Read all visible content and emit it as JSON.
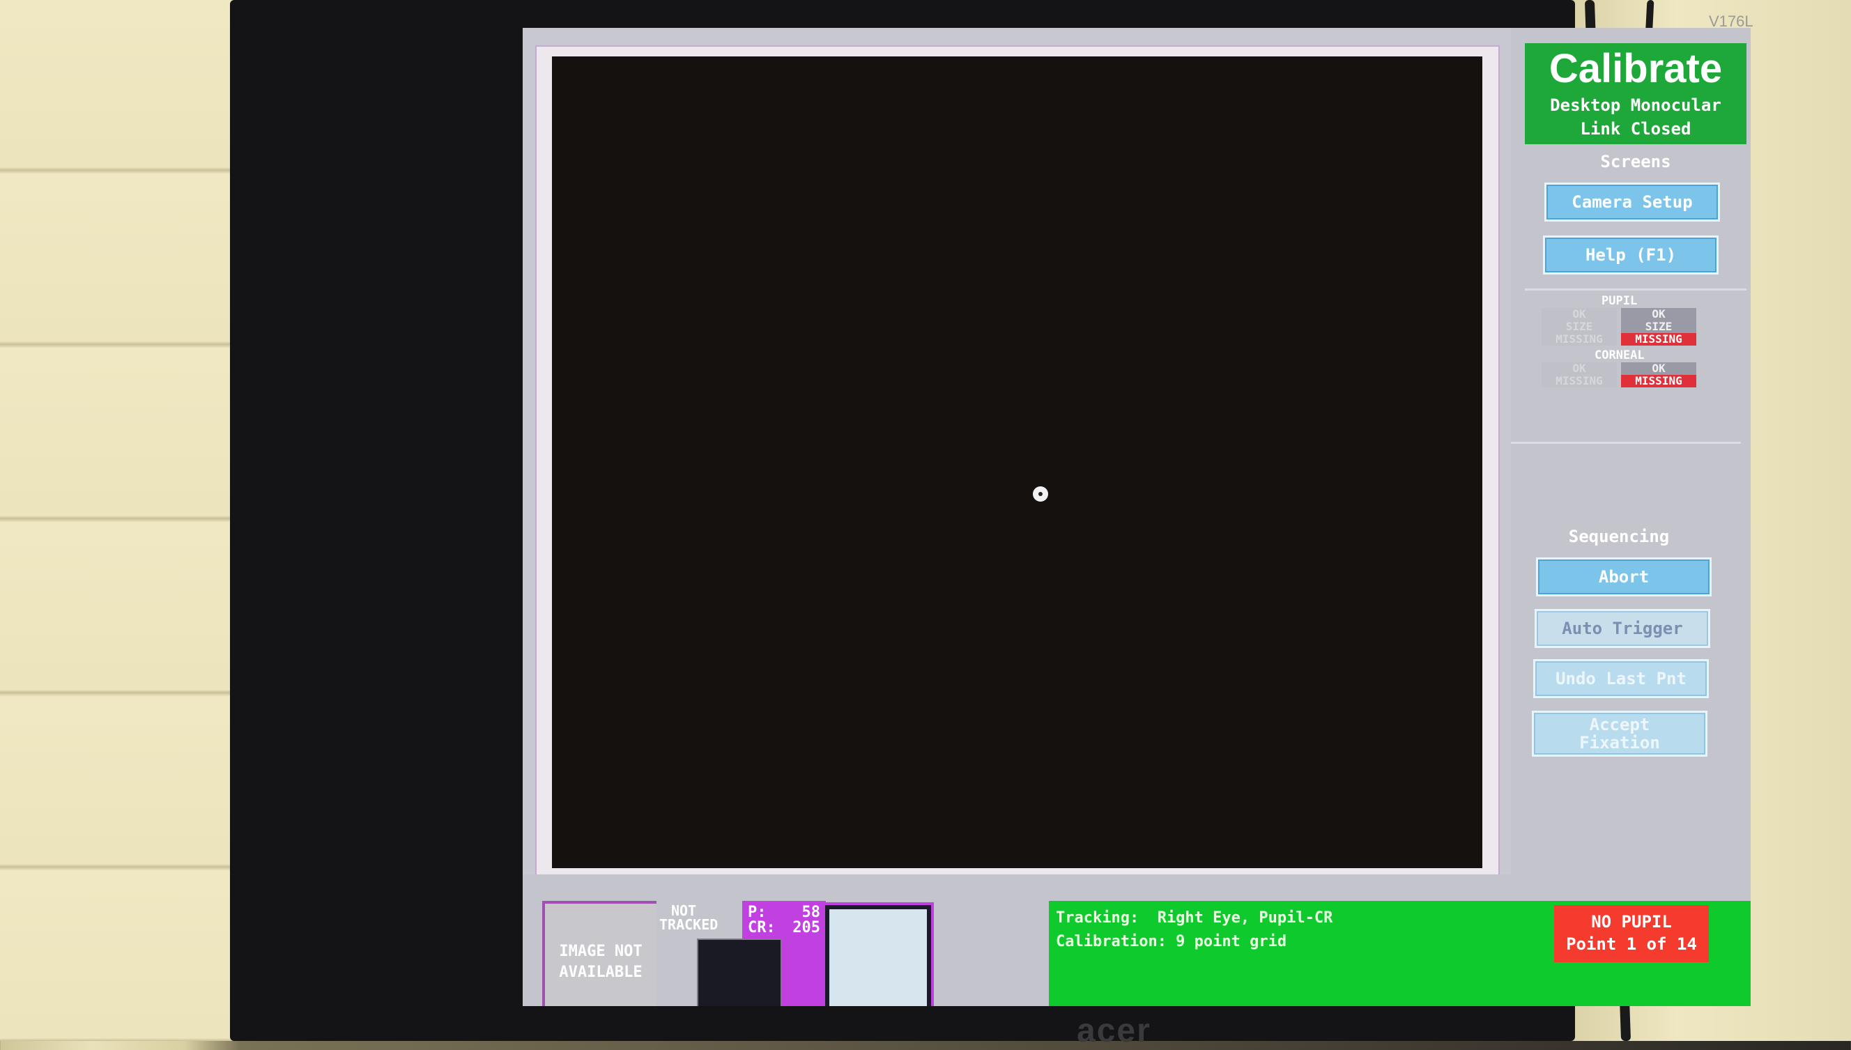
{
  "monitor": {
    "model": "V176L",
    "brand": "acer"
  },
  "calibrate_panel": {
    "title": "Calibrate",
    "mode": "Desktop Monocular",
    "link_status": "Link Closed",
    "screens_label": "Screens",
    "camera_setup_button": "Camera Setup",
    "help_button": "Help (F1)"
  },
  "status_indicators": {
    "pupil_label": "PUPIL",
    "corneal_label": "CORNEAL",
    "pupil_left": {
      "ok": "OK",
      "size": "SIZE",
      "missing": "MISSING"
    },
    "pupil_right": {
      "ok": "OK",
      "size": "SIZE",
      "missing": "MISSING"
    },
    "corneal_left": {
      "ok": "OK",
      "missing": "MISSING"
    },
    "corneal_right": {
      "ok": "OK",
      "missing": "MISSING"
    }
  },
  "sequencing": {
    "label": "Sequencing",
    "abort_button": "Abort",
    "auto_trigger_button": "Auto Trigger",
    "undo_last_button": "Undo Last Pnt",
    "accept_fixation_line1": "Accept",
    "accept_fixation_line2": "Fixation"
  },
  "bottom_bar": {
    "image_na_line1": "IMAGE NOT",
    "image_na_line2": "AVAILABLE",
    "not_tracked_line1": "NOT",
    "not_tracked_line2": "TRACKED",
    "p_label": "P:",
    "p_value": "58",
    "cr_label": "CR:",
    "cr_value": "205",
    "tracking_text": "Tracking:  Right Eye, Pupil-CR",
    "calibration_text": "Calibration: 9 point grid",
    "alert_line1": "NO PUPIL",
    "alert_line2": "Point 1 of 14"
  },
  "colors": {
    "header_green": "#1ea83a",
    "info_green": "#0eca2c",
    "missing_red": "#e0303a",
    "alert_red": "#f53a2e",
    "button_blue": "#7cc4ea",
    "pcr_magenta": "#c040e0"
  }
}
